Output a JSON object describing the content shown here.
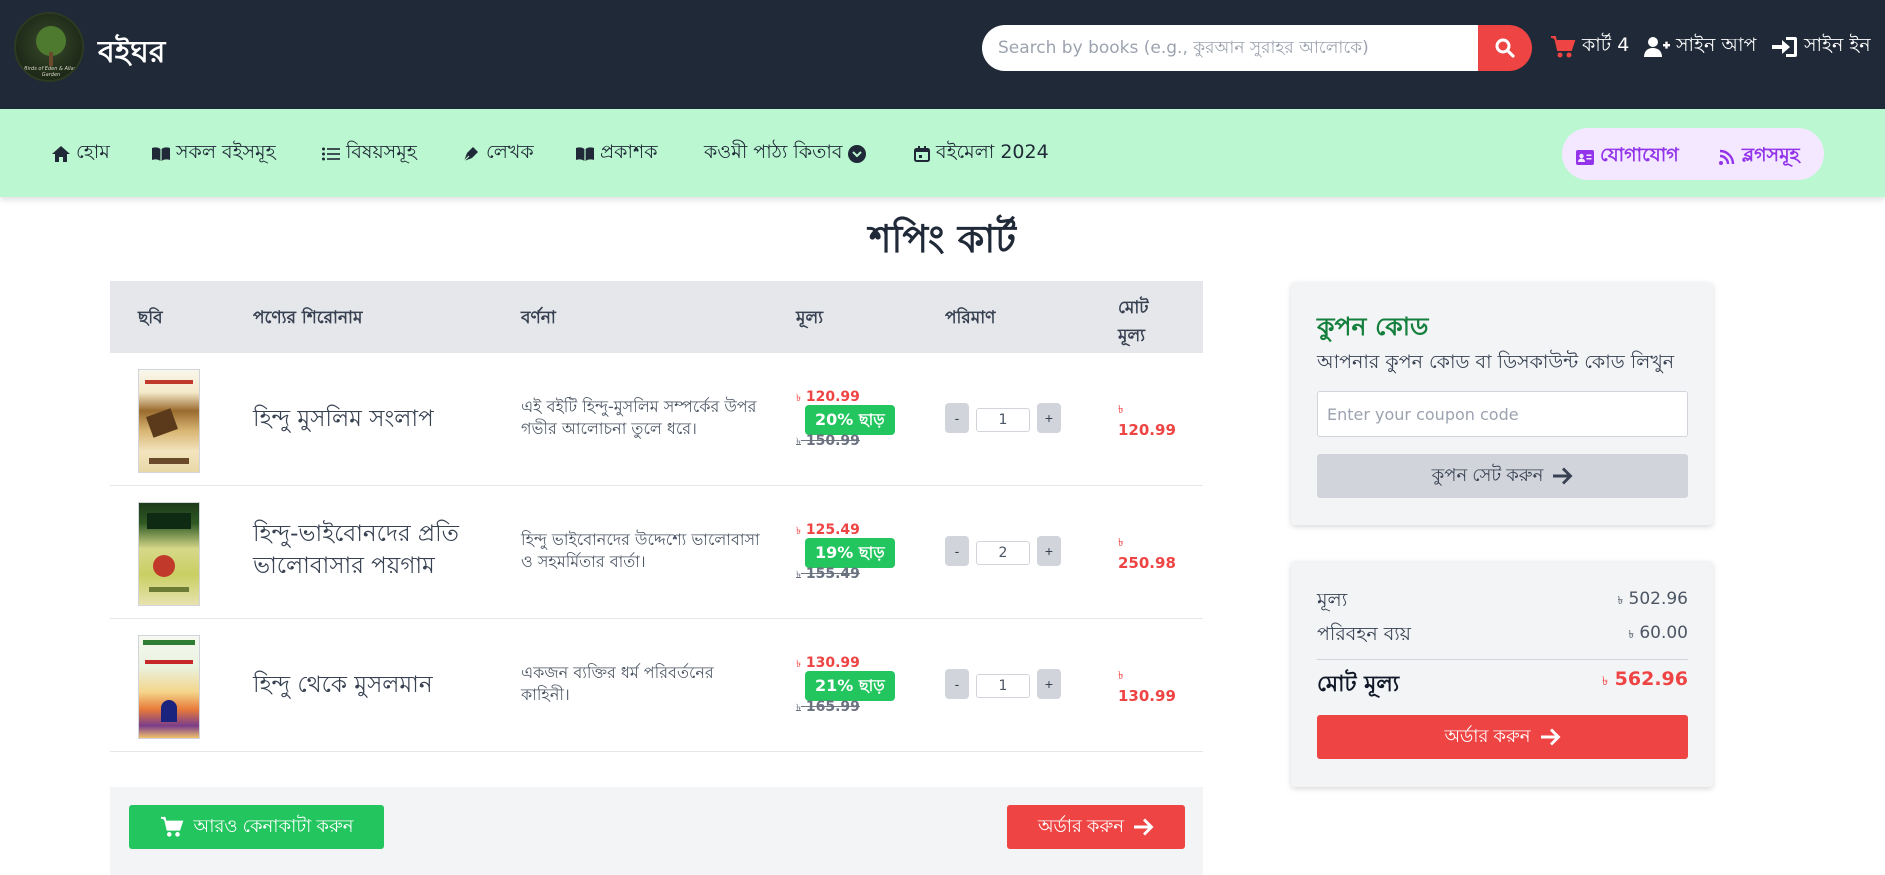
{
  "header": {
    "brand": "বইঘর",
    "logo_caption": "Birds of Eden & Allaw Garden",
    "search_placeholder": "Search by books (e.g., কুরআন সুরাহর আলোকে)",
    "cart_label": "কার্ট 4",
    "signup_label": "সাইন আপ",
    "signin_label": "সাইন ইন",
    "bg_color": "#1f2937",
    "accent_color": "#ef4444"
  },
  "nav": {
    "items": [
      {
        "label": "হোম",
        "icon": "home-icon"
      },
      {
        "label": "সকল বইসমূহ",
        "icon": "book-open-icon"
      },
      {
        "label": "বিষয়সমূহ",
        "icon": "list-icon"
      },
      {
        "label": "লেখক",
        "icon": "pen-icon"
      },
      {
        "label": "প্রকাশক",
        "icon": "book-open-icon"
      },
      {
        "label": "কওমী পাঠ্য কিতাব",
        "icon": "chevron-circle-down-icon"
      },
      {
        "label": "বইমেলা 2024",
        "icon": "calendar-icon"
      }
    ],
    "contact_label": "যোগাযোগ",
    "blogs_label": "ব্লগসমূহ",
    "bg_color": "#bbf7d0",
    "pill_color": "#9333ea"
  },
  "page_title": "শপিং কার্ট",
  "table": {
    "headers": {
      "image": "ছবি",
      "title": "পণ্যের শিরোনাম",
      "description": "বর্ণনা",
      "price": "মূল্য",
      "quantity": "পরিমাণ",
      "total_line1": "মোট",
      "total_line2": "মূল্য"
    },
    "rows": [
      {
        "title": "হিন্দু মুসলিম সংলাপ",
        "description": "এই বইটি হিন্দু-মুসলিম সম্পর্কের উপর গভীর আলোচনা তুলে ধরে।",
        "price": "120.99",
        "discount": "20% ছাড়",
        "old_price": "150.99",
        "qty": "1",
        "total": "120.99"
      },
      {
        "title": "হিন্দু-ভাইবোনদের প্রতি ভালোবাসার পয়গাম",
        "description": "হিন্দু ভাইবোনদের উদ্দেশ্যে ভালোবাসা ও সহমর্মিতার বার্তা।",
        "price": "125.49",
        "discount": "19% ছাড়",
        "old_price": "155.49",
        "qty": "2",
        "total": "250.98"
      },
      {
        "title": "হিন্দু থেকে মুসলমান",
        "description": "একজন ব্যক্তির ধর্ম পরিবর্তনের কাহিনী।",
        "price": "130.99",
        "discount": "21% ছাড়",
        "old_price": "165.99",
        "qty": "1",
        "total": "130.99"
      }
    ],
    "currency_symbol": "৳",
    "qty_minus": "-",
    "qty_plus": "+"
  },
  "actions": {
    "continue_shopping": "আরও কেনাকাটা করুন",
    "place_order": "অর্ডার করুন"
  },
  "coupon": {
    "title": "কুপন কোড",
    "subtitle": "আপনার কুপন কোড বা ডিসকাউন্ট কোড লিখুন",
    "placeholder": "Enter your coupon code",
    "button": "কুপন সেট করুন"
  },
  "summary": {
    "price_label": "মূল্য",
    "price_value": "502.96",
    "shipping_label": "পরিবহন ব্যয়",
    "shipping_value": "60.00",
    "total_label": "মোট মূল্য",
    "total_value": "562.96",
    "order_button": "অর্ডার করুন"
  }
}
